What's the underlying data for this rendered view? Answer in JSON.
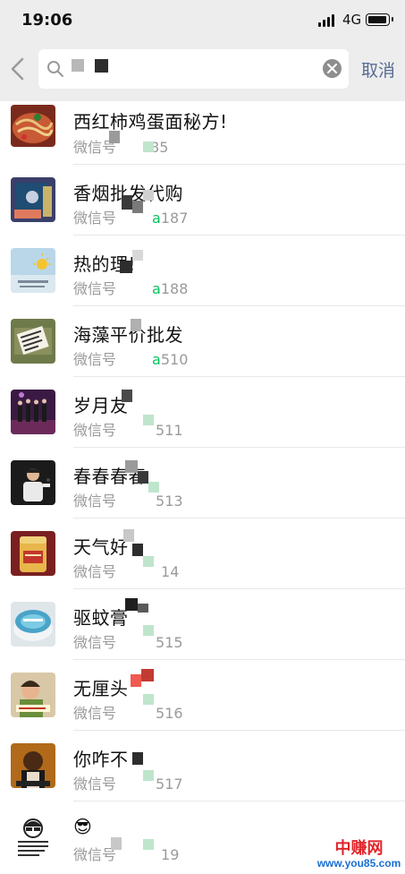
{
  "status_bar": {
    "time": "19:06",
    "network": "4G"
  },
  "search": {
    "value": "",
    "cancel_label": "取消"
  },
  "results": [
    {
      "name": "西红柿鸡蛋面秘方!",
      "wxid_prefix": "微信号",
      "wxid_tail": "85",
      "wxid_hl": ""
    },
    {
      "name": "香烟批发代购",
      "wxid_prefix": "微信号",
      "wxid_tail": "187",
      "wxid_hl": "a"
    },
    {
      "name": "热的理!",
      "wxid_prefix": "微信号",
      "wxid_tail": "188",
      "wxid_hl": "a"
    },
    {
      "name": "海藻平价批发",
      "wxid_prefix": "微信号",
      "wxid_tail": "510",
      "wxid_hl": "a"
    },
    {
      "name": "岁月友",
      "wxid_prefix": "微信号",
      "wxid_tail": "511",
      "wxid_hl": ""
    },
    {
      "name": "春春春春",
      "wxid_prefix": "微信号",
      "wxid_tail": "513",
      "wxid_hl": ""
    },
    {
      "name": "天气好",
      "wxid_prefix": "微信号",
      "wxid_tail": "14",
      "wxid_hl": ""
    },
    {
      "name": "驱蚊膏",
      "wxid_prefix": "微信号",
      "wxid_tail": "515",
      "wxid_hl": ""
    },
    {
      "name": "无厘头",
      "wxid_prefix": "微信号",
      "wxid_tail": "516",
      "wxid_hl": ""
    },
    {
      "name": "你咋不",
      "wxid_prefix": "微信号",
      "wxid_tail": "517",
      "wxid_hl": ""
    },
    {
      "name": "😎",
      "wxid_prefix": "微信号",
      "wxid_tail": "19",
      "wxid_hl": ""
    }
  ],
  "watermark": {
    "line1": "中赚网",
    "line2": "www.you85.com"
  },
  "colors": {
    "header_bg": "#ededed",
    "link_blue": "#576b95",
    "match_green": "#07c160",
    "secondary_text": "#9a9a9a"
  },
  "icons": [
    "back-chevron-icon",
    "search-icon",
    "clear-icon",
    "signal-icon",
    "battery-icon"
  ]
}
